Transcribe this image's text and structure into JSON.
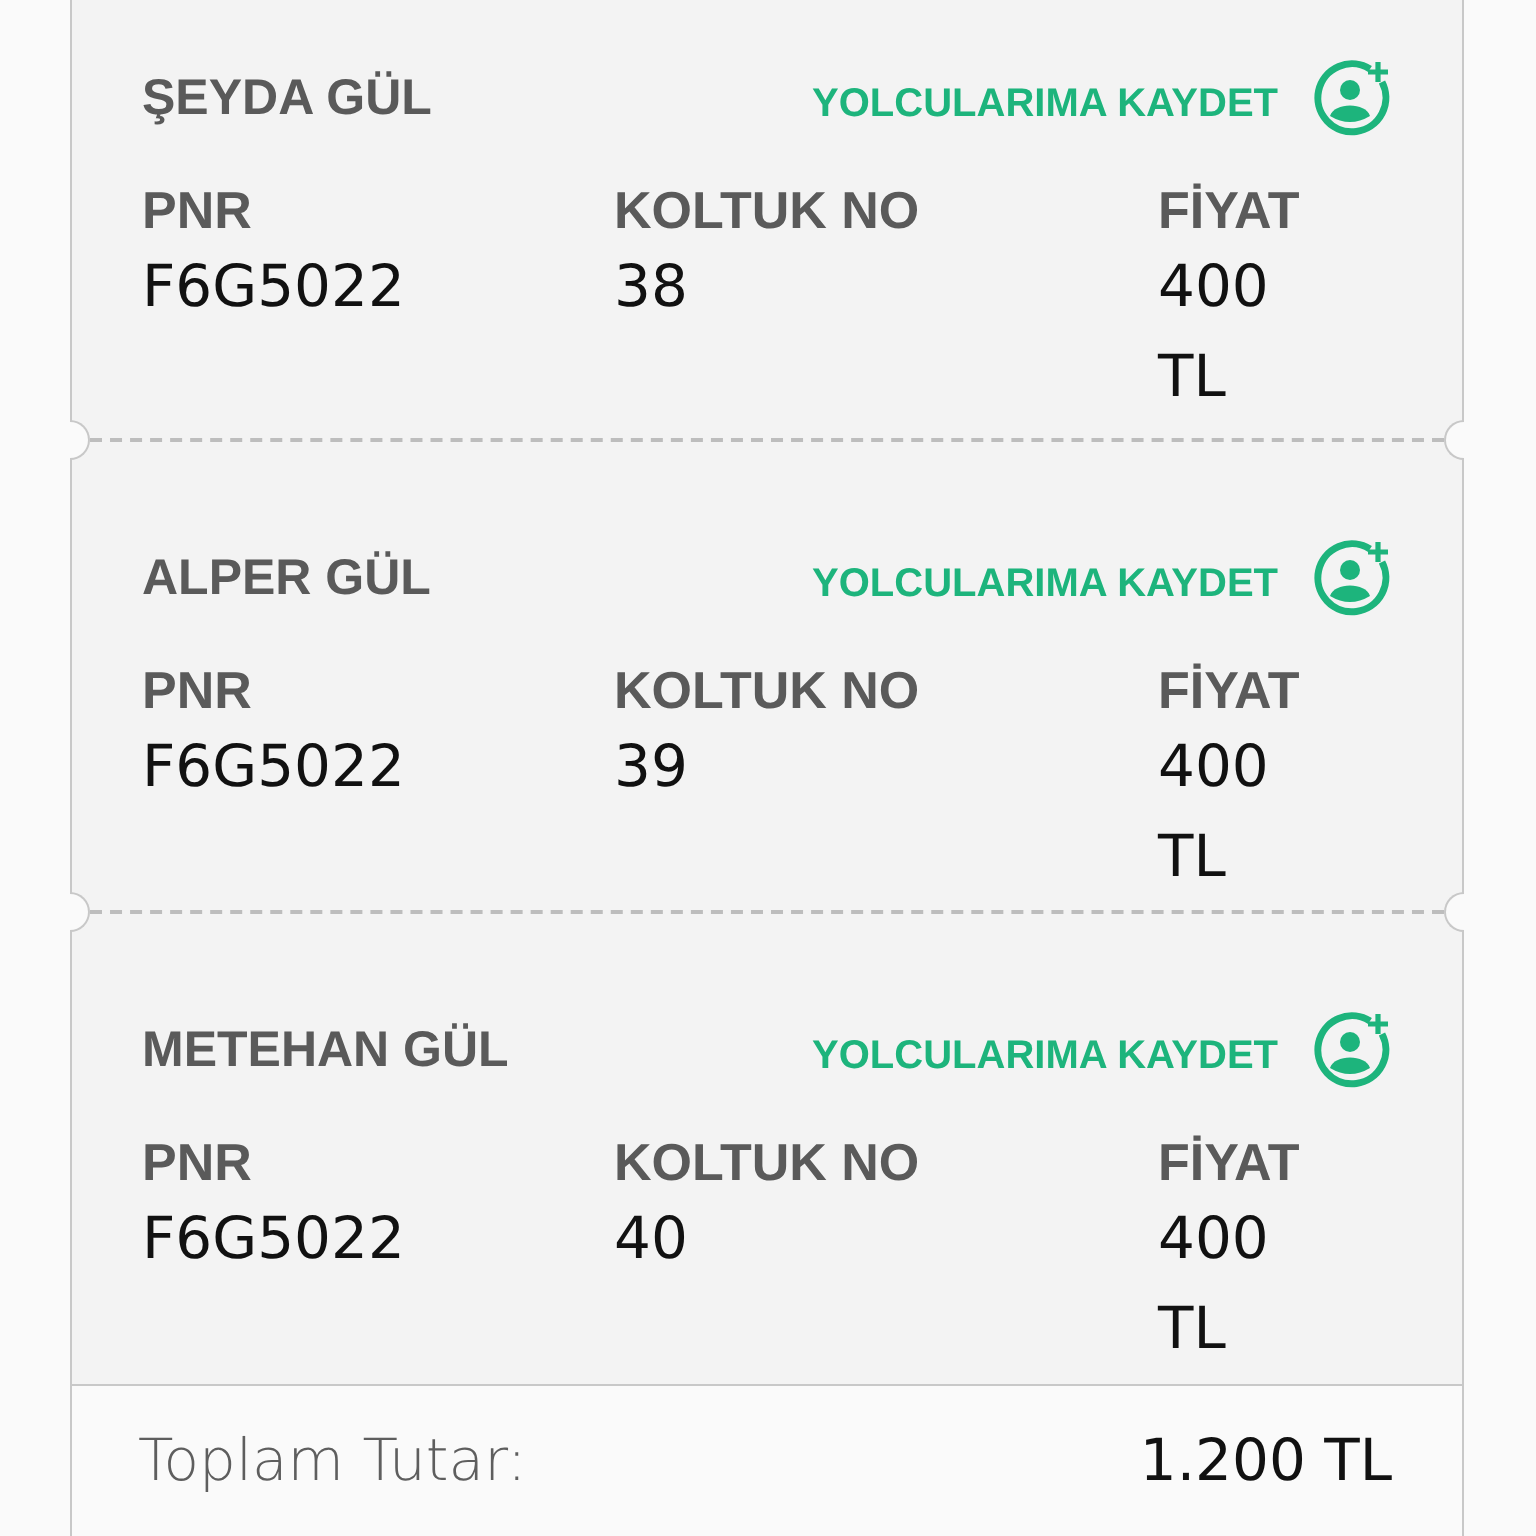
{
  "passengers": [
    {
      "name": "ŞEYDA GÜL",
      "save_action": "YOLCULARIMA KAYDET",
      "fields": [
        {
          "label": "PNR",
          "value": "F6G5022"
        },
        {
          "label": "KOLTUK NO",
          "value": "38"
        },
        {
          "label": "FİYAT",
          "value": "400 TL"
        }
      ]
    },
    {
      "name": "ALPER GÜL",
      "save_action": "YOLCULARIMA KAYDET",
      "fields": [
        {
          "label": "PNR",
          "value": "F6G5022"
        },
        {
          "label": "KOLTUK NO",
          "value": "39"
        },
        {
          "label": "FİYAT",
          "value": "400 TL"
        }
      ]
    },
    {
      "name": "METEHAN GÜL",
      "save_action": "YOLCULARIMA KAYDET",
      "fields": [
        {
          "label": "PNR",
          "value": "F6G5022"
        },
        {
          "label": "KOLTUK NO",
          "value": "40"
        },
        {
          "label": "FİYAT",
          "value": "400 TL"
        }
      ]
    }
  ],
  "total": {
    "label": "Toplam Tutar:",
    "value": "1.200 TL"
  }
}
